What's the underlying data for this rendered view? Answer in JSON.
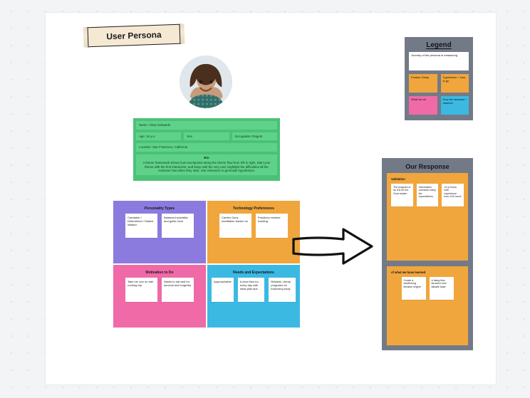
{
  "title": "User Persona",
  "avatar_desc": "Smiling woman with curly brown hair wearing a patterned top",
  "persona": {
    "name_label": "Name: Alison Edwards",
    "age": "Age: 34 y.o.",
    "sex": "Sex",
    "role": "Occupation: Regent",
    "location": "Location: San Francisco, California",
    "bio_heading": "Bio",
    "bio_body": "A theme framework shows how touchpoints along the theme flow from left to right. Start your theme with the first interaction, and keep until the very end. Highlight the difficulties all the customer has when they start. Use relevance to generate hypotheses."
  },
  "panels": {
    "purple": {
      "title": "Personality Types",
      "color": "#8b7bdf",
      "notes": [
        "Caretaker / Determined / Dialect initiator",
        "Balanced wordslist, and guide lover"
      ]
    },
    "orange": {
      "title": "Technology Preferences",
      "color": "#f0a63d",
      "notes": [
        "Carries Oura, meditation tracker on",
        "Practices emotive tracking"
      ]
    },
    "pink": {
      "title": "Motivation to Do",
      "color": "#f06aa8",
      "notes": [
        "Take her son on trail running trip",
        "Wants to eat well for survival and longevity"
      ]
    },
    "blue": {
      "title": "Needs and Expectations",
      "color": "#3bb9e3",
      "notes": [
        "Approachable",
        "A clear flow for every day with meal-plan tips",
        "Reliable, cheap programs for improving body"
      ]
    }
  },
  "legend": {
    "title": "Legend",
    "items": [
      {
        "label": "Journey of the persona in measuring",
        "bg": "#ffffff"
      },
      {
        "label": "Type/factor = how to go",
        "bg": "#f0a63d"
      },
      {
        "label": "Feature Study",
        "bg": "#f0a63d"
      },
      {
        "label": "What we do",
        "bg": "#f06aa8"
      },
      {
        "label": "How we measure / observe",
        "bg": "#3bb9e3"
      }
    ]
  },
  "response": {
    "title": "Our Response",
    "blocks": [
      {
        "caption": "Validation",
        "notes": [
          "The program is as it is for the Oura reader",
          "Information connects many tier expectations",
          "14 yr focus with experience from 124 hours"
        ]
      },
      {
        "caption": "of what we have learned",
        "notes": [
          "Create a weathering iteration engine",
          "A rising flow structure and failsafe base"
        ]
      }
    ]
  },
  "colors": {
    "canvas": "#ffffff",
    "page": "#f2f4f6",
    "green": "#4bc177",
    "greenCell": "#5fd289",
    "gray": "#737a87"
  }
}
